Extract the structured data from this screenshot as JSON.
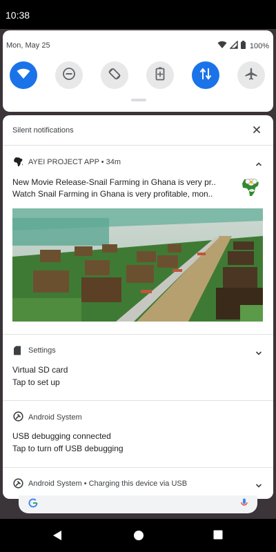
{
  "status_bar": {
    "time": "10:38"
  },
  "quick_settings": {
    "date": "Mon, May 25",
    "battery": "100%",
    "tiles": [
      {
        "name": "wifi",
        "icon": "wifi-icon",
        "active": true
      },
      {
        "name": "do-not-disturb",
        "icon": "minus-circle-icon",
        "active": false
      },
      {
        "name": "auto-rotate",
        "icon": "rotate-icon",
        "active": false
      },
      {
        "name": "battery-saver",
        "icon": "battery-saver-icon",
        "active": false
      },
      {
        "name": "mobile-data",
        "icon": "data-arrows-icon",
        "active": true
      },
      {
        "name": "airplane-mode",
        "icon": "airplane-icon",
        "active": false
      }
    ],
    "colors": {
      "active": "#1a73e8",
      "inactive": "#e8e8e8"
    }
  },
  "shade": {
    "header": "Silent notifications",
    "notifications": [
      {
        "app": "AYEI PROJECT APP • 34m",
        "line1": "New Movie Release-Snail Farming in Ghana is very pr..",
        "line2": "Watch Snail Farming in Ghana is very profitable, mon..",
        "icon": "africa-map-icon",
        "expanded": true
      },
      {
        "app": "Settings",
        "line1": "Virtual SD card",
        "line2": "Tap to set up",
        "icon": "sd-card-icon"
      },
      {
        "app": "Android System",
        "line1": "USB debugging connected",
        "line2": "Tap to turn off USB debugging",
        "icon": "android-system-icon"
      },
      {
        "app": "Android System • Charging this device via USB",
        "icon": "android-system-icon"
      }
    ]
  },
  "navbar": {
    "buttons": [
      "back-icon",
      "home-icon",
      "recents-icon"
    ]
  }
}
